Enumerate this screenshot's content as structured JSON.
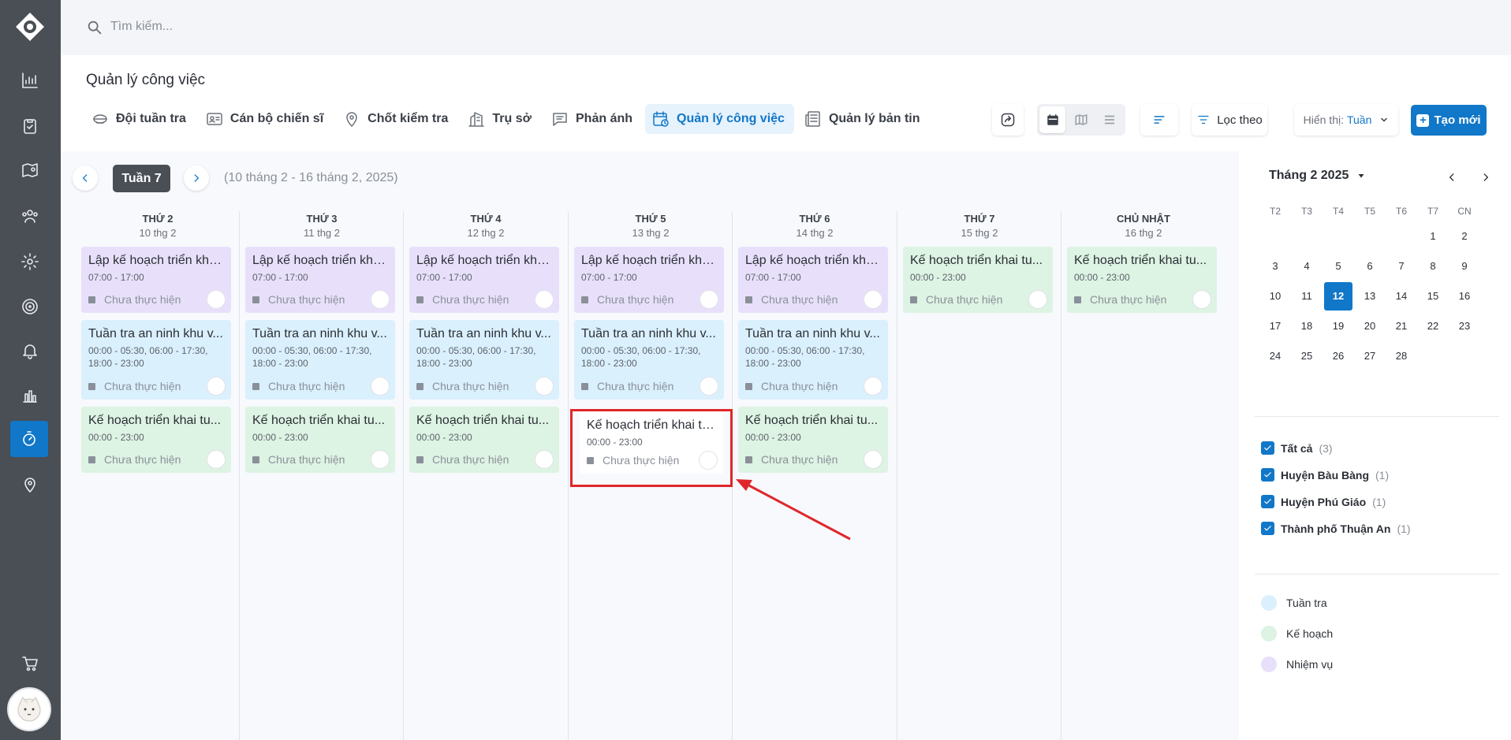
{
  "search": {
    "placeholder": "Tìm kiếm..."
  },
  "sidebar": {
    "items": [
      {
        "icon": "bar-chart-icon"
      },
      {
        "icon": "clipboard-check-icon"
      },
      {
        "icon": "map-pin-icon"
      },
      {
        "icon": "team-icon"
      },
      {
        "icon": "gear-icon"
      },
      {
        "icon": "target-icon"
      },
      {
        "icon": "bell-icon"
      },
      {
        "icon": "column-chart-icon"
      },
      {
        "icon": "stopwatch-icon",
        "active": true
      },
      {
        "icon": "location-user-icon"
      }
    ],
    "cart_icon": "cart-icon"
  },
  "header": {
    "title": "Quản lý công việc",
    "tabs": [
      {
        "label": "Đội tuần tra",
        "icon": "patrol-icon"
      },
      {
        "label": "Cán bộ chiến sĩ",
        "icon": "id-card-icon"
      },
      {
        "label": "Chốt kiểm tra",
        "icon": "pin-icon"
      },
      {
        "label": "Trụ sở",
        "icon": "building-icon"
      },
      {
        "label": "Phản ánh",
        "icon": "comment-icon"
      },
      {
        "label": "Quản lý công việc",
        "icon": "calendar-clock-icon",
        "active": true
      },
      {
        "label": "Quản lý bản tin",
        "icon": "newspaper-icon"
      }
    ],
    "filter_label": "Lọc theo",
    "display_label": "Hiển thị:",
    "display_value": "Tuần",
    "create_label": "Tạo mới"
  },
  "calendar": {
    "week_label": "Tuần 7",
    "range": "(10 tháng 2 - 16 tháng 2, 2025)",
    "days": [
      {
        "name": "THỨ 2",
        "date": "10 thg 2"
      },
      {
        "name": "THỨ 3",
        "date": "11 thg 2"
      },
      {
        "name": "THỨ 4",
        "date": "12 thg 2"
      },
      {
        "name": "THỨ 5",
        "date": "13 thg 2"
      },
      {
        "name": "THỨ 6",
        "date": "14 thg 2"
      },
      {
        "name": "THỨ 7",
        "date": "15 thg 2"
      },
      {
        "name": "CHỦ NHẬT",
        "date": "16 thg 2"
      }
    ],
    "events": {
      "nhiem_vu": {
        "title": "Lập kế hoạch triển kha...",
        "time": "07:00 - 17:00",
        "status": "Chưa thực hiện"
      },
      "tuan_tra": {
        "title": "Tuần tra an ninh khu v...",
        "time": "00:00 - 05:30, 06:00 - 17:30, 18:00 - 23:00",
        "status": "Chưa thực hiện"
      },
      "ke_hoach": {
        "title": "Kế hoạch triển khai tu...",
        "time": "00:00 - 23:00",
        "status": "Chưa thực hiện"
      }
    }
  },
  "mini_calendar": {
    "title": "Tháng 2 2025",
    "weekdays": [
      "T2",
      "T3",
      "T4",
      "T5",
      "T6",
      "T7",
      "CN"
    ],
    "weeks": [
      [
        "",
        "",
        "",
        "",
        "",
        "1",
        "2"
      ],
      [
        "3",
        "4",
        "5",
        "6",
        "7",
        "8",
        "9"
      ],
      [
        "10",
        "11",
        "12",
        "13",
        "14",
        "15",
        "16"
      ],
      [
        "17",
        "18",
        "19",
        "20",
        "21",
        "22",
        "23"
      ],
      [
        "24",
        "25",
        "26",
        "27",
        "28",
        "",
        ""
      ]
    ],
    "today": "12"
  },
  "filters": [
    {
      "label": "Tất cả",
      "count": "(3)"
    },
    {
      "label": "Huyện Bàu Bàng",
      "count": "(1)"
    },
    {
      "label": "Huyện Phú Giáo",
      "count": "(1)"
    },
    {
      "label": "Thành phố Thuận An",
      "count": "(1)"
    }
  ],
  "legend": [
    {
      "label": "Tuần tra",
      "color": "#daf0fd"
    },
    {
      "label": "Kế hoạch",
      "color": "#ddf3e3"
    },
    {
      "label": "Nhiệm vụ",
      "color": "#e8e0fb"
    }
  ],
  "colors": {
    "accent": "#1177c8",
    "sidebar": "#4a4e55",
    "highlight": "#e0262b"
  }
}
